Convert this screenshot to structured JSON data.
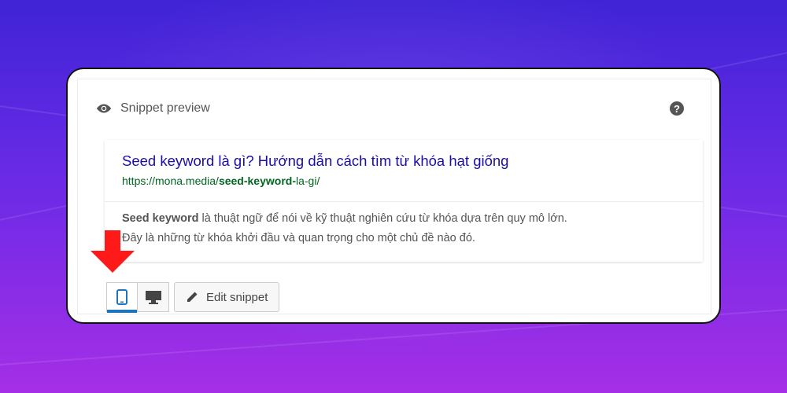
{
  "snippet_preview": {
    "title": "Snippet preview",
    "icon": "eye-icon",
    "help_icon": "question-icon",
    "help_label": "?"
  },
  "serp": {
    "title": "Seed keyword là gì? Hướng dẫn cách tìm từ khóa hạt giống",
    "url_prefix": "https://mona.media/",
    "url_keyword": "seed-keyword-",
    "url_suffix": "la-gi/",
    "desc_keyword": "Seed keyword",
    "desc_line1_rest": " là thuật ngữ để nói về kỹ thuật nghiên cứu từ khóa dựa trên quy mô lớn.",
    "desc_line2": "Đây là những từ khóa khởi đầu và quan trọng cho một chủ đề nào đó."
  },
  "controls": {
    "mobile_icon": "mobile-icon",
    "desktop_icon": "desktop-icon",
    "edit_label": "Edit snippet",
    "edit_icon": "pencil-icon",
    "active_mode": "mobile"
  },
  "annotation": {
    "arrow_icon": "red-arrow-down-icon",
    "arrow_color": "#ff1a1a"
  },
  "colors": {
    "link": "#1a0dab",
    "url": "#006621",
    "active_accent": "#1e73be"
  }
}
